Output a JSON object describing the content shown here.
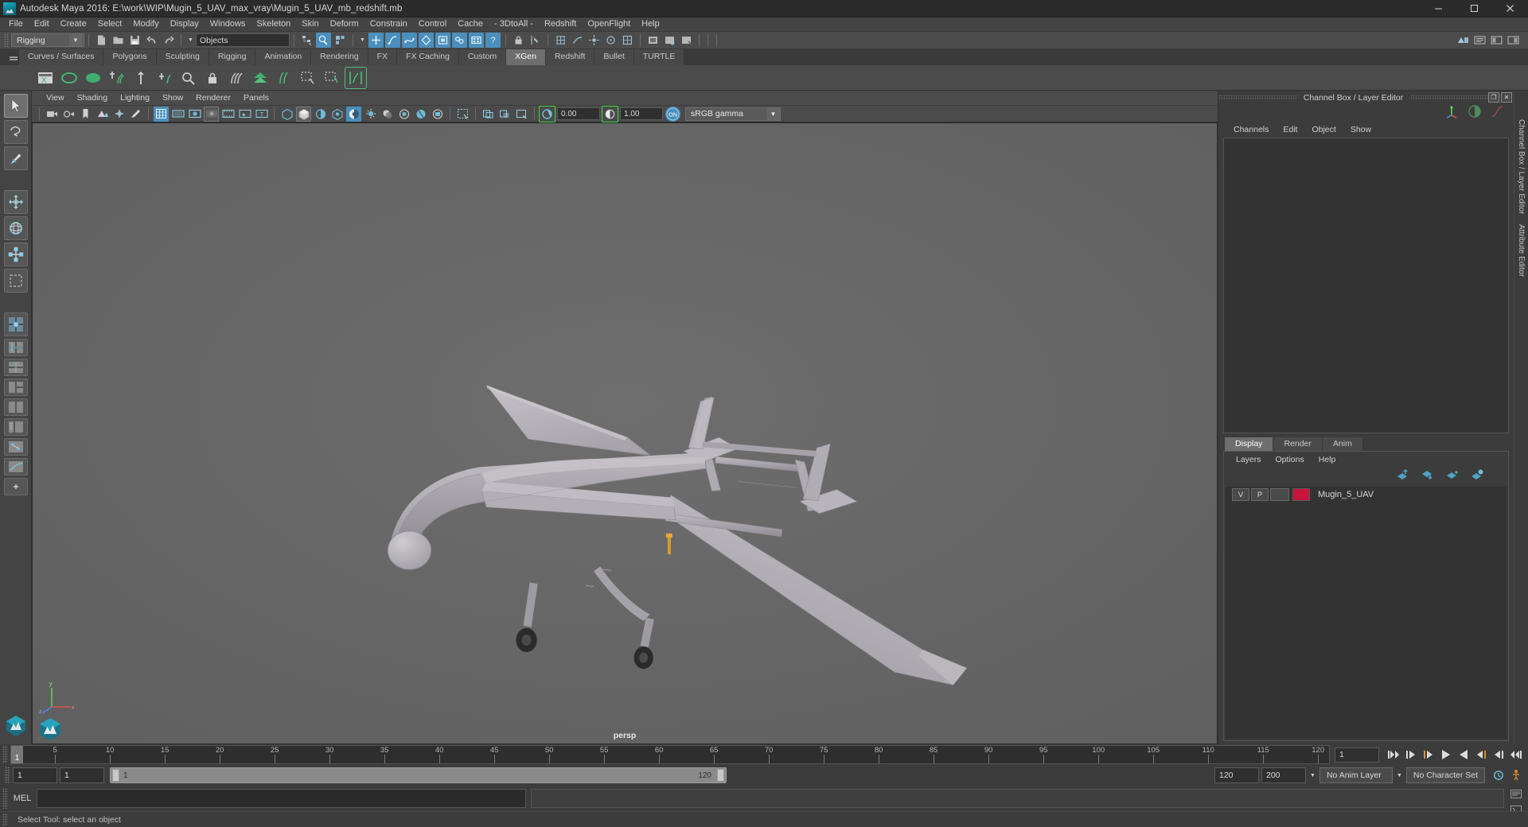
{
  "window": {
    "title": "Autodesk Maya 2016: E:\\work\\WIP\\Mugin_5_UAV_max_vray\\Mugin_5_UAV_mb_redshift.mb",
    "minimize_label": "–",
    "maximize_label": "▭",
    "close_label": "✕"
  },
  "menubar": {
    "items": [
      {
        "label": "File"
      },
      {
        "label": "Edit"
      },
      {
        "label": "Create"
      },
      {
        "label": "Select"
      },
      {
        "label": "Modify"
      },
      {
        "label": "Display"
      },
      {
        "label": "Windows"
      },
      {
        "label": "Skeleton"
      },
      {
        "label": "Skin"
      },
      {
        "label": "Deform"
      },
      {
        "label": "Constrain"
      },
      {
        "label": "Control"
      },
      {
        "label": "Cache"
      },
      {
        "label": "- 3DtoAll -"
      },
      {
        "label": "Redshift"
      },
      {
        "label": "OpenFlight"
      },
      {
        "label": "Help"
      }
    ]
  },
  "statusline": {
    "menuset": "Rigging",
    "selection_mask": "Objects",
    "selection_mask_placeholder": "Objects"
  },
  "shelf": {
    "tabs": [
      {
        "label": "Curves / Surfaces",
        "active": false
      },
      {
        "label": "Polygons",
        "active": false
      },
      {
        "label": "Sculpting",
        "active": false
      },
      {
        "label": "Rigging",
        "active": false
      },
      {
        "label": "Animation",
        "active": false
      },
      {
        "label": "Rendering",
        "active": false
      },
      {
        "label": "FX",
        "active": false
      },
      {
        "label": "FX Caching",
        "active": false
      },
      {
        "label": "Custom",
        "active": false
      },
      {
        "label": "XGen",
        "active": true
      },
      {
        "label": "Redshift",
        "active": false
      },
      {
        "label": "Bullet",
        "active": false
      },
      {
        "label": "TURTLE",
        "active": false
      }
    ]
  },
  "viewport": {
    "menus": [
      {
        "label": "View"
      },
      {
        "label": "Shading"
      },
      {
        "label": "Lighting"
      },
      {
        "label": "Show"
      },
      {
        "label": "Renderer"
      },
      {
        "label": "Panels"
      }
    ],
    "exposure_value": "0.00",
    "gamma_value": "1.00",
    "color_management_toggle": "ON",
    "color_profile": "sRGB gamma",
    "camera_label": "persp",
    "axis_x": "x",
    "axis_y": "y",
    "axis_z": "z"
  },
  "channel_box": {
    "panel_title": "Channel Box / Layer Editor",
    "restore_label": "❐",
    "close_label": "✕",
    "menus": [
      {
        "label": "Channels"
      },
      {
        "label": "Edit"
      },
      {
        "label": "Object"
      },
      {
        "label": "Show"
      }
    ]
  },
  "layer_editor": {
    "tabs": [
      {
        "label": "Display",
        "active": true
      },
      {
        "label": "Render",
        "active": false
      },
      {
        "label": "Anim",
        "active": false
      }
    ],
    "menus": [
      {
        "label": "Layers"
      },
      {
        "label": "Options"
      },
      {
        "label": "Help"
      }
    ],
    "layers": [
      {
        "visibility": "V",
        "playback": "P",
        "shading": "",
        "color": "#c9133f",
        "name": "Mugin_5_UAV"
      }
    ]
  },
  "right_sidebar": {
    "tabs": [
      {
        "label": "Channel Box / Layer Editor"
      },
      {
        "label": "Attribute Editor"
      }
    ]
  },
  "timeline": {
    "start_label": "1",
    "current_frame": "1",
    "ticks": [
      5,
      10,
      15,
      20,
      25,
      30,
      35,
      40,
      45,
      50,
      55,
      60,
      65,
      70,
      75,
      80,
      85,
      90,
      95,
      100,
      105,
      110,
      115,
      120
    ],
    "range_min": 1,
    "range_max": 121,
    "playback_buttons": [
      {
        "name": "go-to-start-button",
        "glyph": "start"
      },
      {
        "name": "step-back-keyframe-button",
        "glyph": "prevkey"
      },
      {
        "name": "step-back-frame-button",
        "glyph": "prevframe"
      },
      {
        "name": "play-backwards-button",
        "glyph": "playback"
      },
      {
        "name": "play-forwards-button",
        "glyph": "playfwd"
      },
      {
        "name": "step-forward-frame-button",
        "glyph": "nextframe"
      },
      {
        "name": "step-forward-keyframe-button",
        "glyph": "nextkey"
      },
      {
        "name": "go-to-end-button",
        "glyph": "end"
      }
    ]
  },
  "range_slider": {
    "anim_start": "1",
    "playback_start": "1",
    "bar_start": "1",
    "bar_end": "120",
    "playback_end": "120",
    "anim_end": "200",
    "anim_layer": "No Anim Layer",
    "character_set": "No Character Set"
  },
  "command_line": {
    "language": "MEL",
    "input_value": "",
    "output_value": ""
  },
  "help_line": {
    "text": "Select Tool: select an object"
  },
  "toolbox": {
    "tools": [
      {
        "name": "select-tool",
        "label": "Select Tool",
        "selected": true
      },
      {
        "name": "lasso-tool",
        "label": "Lasso Tool",
        "selected": false
      },
      {
        "name": "paint-select-tool",
        "label": "Paint Select Tool",
        "selected": false
      },
      {
        "name": "move-tool",
        "label": "Move Tool",
        "selected": false
      },
      {
        "name": "rotate-tool",
        "label": "Rotate Tool",
        "selected": false
      },
      {
        "name": "scale-tool",
        "label": "Scale Tool",
        "selected": false
      },
      {
        "name": "last-tool",
        "label": "Last Tool Used",
        "selected": false
      }
    ],
    "layouts": [
      {
        "name": "single-perspective-layout"
      },
      {
        "name": "four-view-layout"
      },
      {
        "name": "three-view-split-layout"
      },
      {
        "name": "two-stacked-layout"
      },
      {
        "name": "two-side-layout"
      },
      {
        "name": "outliner-persp-layout"
      },
      {
        "name": "hypergraph-persp-layout"
      },
      {
        "name": "persp-graph-layout"
      },
      {
        "name": "more-layouts"
      }
    ]
  }
}
